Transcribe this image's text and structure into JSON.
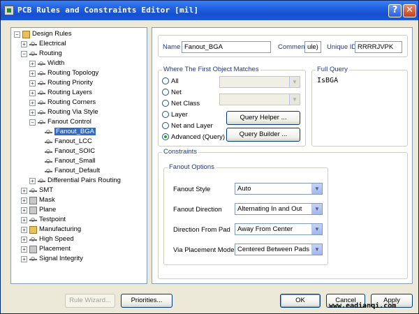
{
  "window": {
    "title": "PCB Rules and Constraints Editor [mil]",
    "help_label": "?",
    "close_label": "✕"
  },
  "tree": {
    "items": [
      {
        "label": "Design Rules",
        "expander": "−",
        "icon": "rules-root-icon"
      },
      {
        "label": "Electrical",
        "expander": "+",
        "icon": "electrical-icon"
      },
      {
        "label": "Routing",
        "expander": "−",
        "icon": "routing-icon"
      },
      {
        "label": "Width",
        "expander": "+",
        "icon": "rule-icon"
      },
      {
        "label": "Routing Topology",
        "expander": "+",
        "icon": "rule-icon"
      },
      {
        "label": "Routing Priority",
        "expander": "+",
        "icon": "rule-icon"
      },
      {
        "label": "Routing Layers",
        "expander": "+",
        "icon": "rule-icon"
      },
      {
        "label": "Routing Corners",
        "expander": "+",
        "icon": "rule-icon"
      },
      {
        "label": "Routing Via Style",
        "expander": "+",
        "icon": "rule-icon"
      },
      {
        "label": "Fanout Control",
        "expander": "−",
        "icon": "rule-icon"
      },
      {
        "label": "Fanout_BGA",
        "expander": "",
        "icon": "rule-icon"
      },
      {
        "label": "Fanout_LCC",
        "expander": "",
        "icon": "rule-icon"
      },
      {
        "label": "Fanout_SOIC",
        "expander": "",
        "icon": "rule-icon"
      },
      {
        "label": "Fanout_Small",
        "expander": "",
        "icon": "rule-icon"
      },
      {
        "label": "Fanout_Default",
        "expander": "",
        "icon": "rule-icon"
      },
      {
        "label": "Differential Pairs Routing",
        "expander": "+",
        "icon": "rule-icon"
      },
      {
        "label": "SMT",
        "expander": "+",
        "icon": "smt-icon"
      },
      {
        "label": "Mask",
        "expander": "+",
        "icon": "mask-icon"
      },
      {
        "label": "Plane",
        "expander": "+",
        "icon": "plane-icon"
      },
      {
        "label": "Testpoint",
        "expander": "+",
        "icon": "testpoint-icon"
      },
      {
        "label": "Manufacturing",
        "expander": "+",
        "icon": "manufacturing-icon"
      },
      {
        "label": "High Speed",
        "expander": "+",
        "icon": "high-speed-icon"
      },
      {
        "label": "Placement",
        "expander": "+",
        "icon": "placement-icon"
      },
      {
        "label": "Signal Integrity",
        "expander": "+",
        "icon": "signal-integrity-icon"
      }
    ]
  },
  "rule": {
    "name_label": "Name",
    "name_value": "Fanout_BGA",
    "comment_label": "Comment",
    "comment_value": "ule)",
    "uid_label": "Unique ID",
    "uid_value": "RRRRJVPK"
  },
  "match": {
    "title": "Where The First Object Matches",
    "options": [
      "All",
      "Net",
      "Net Class",
      "Layer",
      "Net and Layer",
      "Advanced (Query)"
    ],
    "selected": "Advanced (Query)",
    "query_helper_label": "Query Helper ...",
    "query_builder_label": "Query Builder ..."
  },
  "full_query": {
    "title": "Full Query",
    "text": "IsBGA"
  },
  "constraints": {
    "title": "Constraints",
    "fanout_options_title": "Fanout Options",
    "rows": [
      {
        "label": "Fanout Style",
        "value": "Auto"
      },
      {
        "label": "Fanout Direction",
        "value": "Alternating In and Out"
      },
      {
        "label": "Direction From Pad",
        "value": "Away From Center"
      },
      {
        "label": "Via Placement Mode",
        "value": "Centered Between Pads"
      }
    ]
  },
  "buttons": {
    "rule_wizard": "Rule Wizard...",
    "priorities": "Priorities...",
    "ok": "OK",
    "cancel": "Cancel",
    "apply": "Apply"
  },
  "watermark": "www.eadianqi.com"
}
